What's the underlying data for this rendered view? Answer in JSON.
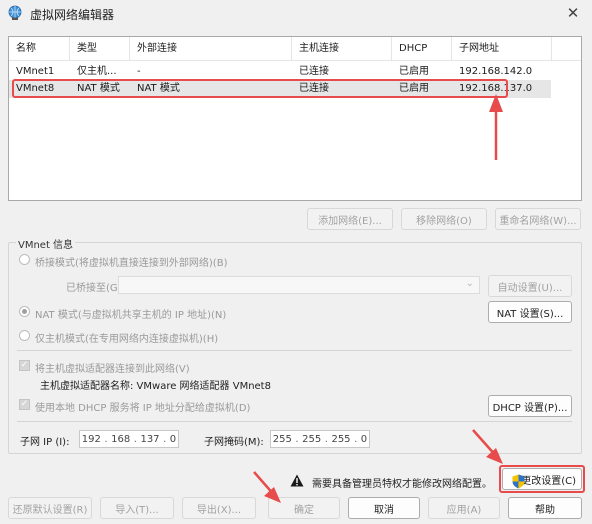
{
  "window": {
    "title": "虚拟网络编辑器",
    "close_glyph": "✕"
  },
  "list": {
    "columns": [
      "名称",
      "类型",
      "外部连接",
      "主机连接",
      "DHCP",
      "子网地址"
    ],
    "rows": [
      [
        "VMnet1",
        "仅主机...",
        "-",
        "已连接",
        "已启用",
        "192.168.142.0"
      ],
      [
        "VMnet8",
        "NAT 模式",
        "NAT 模式",
        "已连接",
        "已启用",
        "192.168.137.0"
      ]
    ]
  },
  "list_buttons": {
    "add": "添加网络(E)...",
    "remove": "移除网络(O)",
    "rename": "重命名网络(W)..."
  },
  "vmnet_info": {
    "title": "VMnet 信息",
    "bridged_label": "桥接模式(将虚拟机直接连接到外部网络)(B)",
    "bridged_to_label": "已桥接至(G):",
    "bridged_to_value": "",
    "auto_settings": "自动设置(U)...",
    "nat_label": "NAT 模式(与虚拟机共享主机的 IP 地址)(N)",
    "nat_settings": "NAT 设置(S)...",
    "hostonly_label": "仅主机模式(在专用网络内连接虚拟机)(H)",
    "connect_adapter_label": "将主机虚拟适配器连接到此网络(V)",
    "adapter_name_label": "主机虚拟适配器名称: VMware 网络适配器 VMnet8",
    "dhcp_label": "使用本地 DHCP 服务将 IP 地址分配给虚拟机(D)",
    "dhcp_settings": "DHCP 设置(P)...",
    "subnet_ip_label": "子网 IP (I):",
    "subnet_ip": [
      "192",
      "168",
      "137",
      "0"
    ],
    "subnet_mask_label": "子网掩码(M):",
    "subnet_mask": [
      "255",
      "255",
      "255",
      "0"
    ]
  },
  "admin_notice": {
    "text": "需要具备管理员特权才能修改网络配置。",
    "change_settings": "更改设置(C)"
  },
  "footer": {
    "restore": "还原默认设置(R)",
    "import": "导入(T)...",
    "export": "导出(X)...",
    "ok": "确定",
    "cancel": "取消",
    "apply": "应用(A)",
    "help": "帮助"
  },
  "colors": {
    "annotation_red": "#e84b4b",
    "selected_row": "#e6e6e6",
    "window_bg": "#f0f0f0"
  }
}
